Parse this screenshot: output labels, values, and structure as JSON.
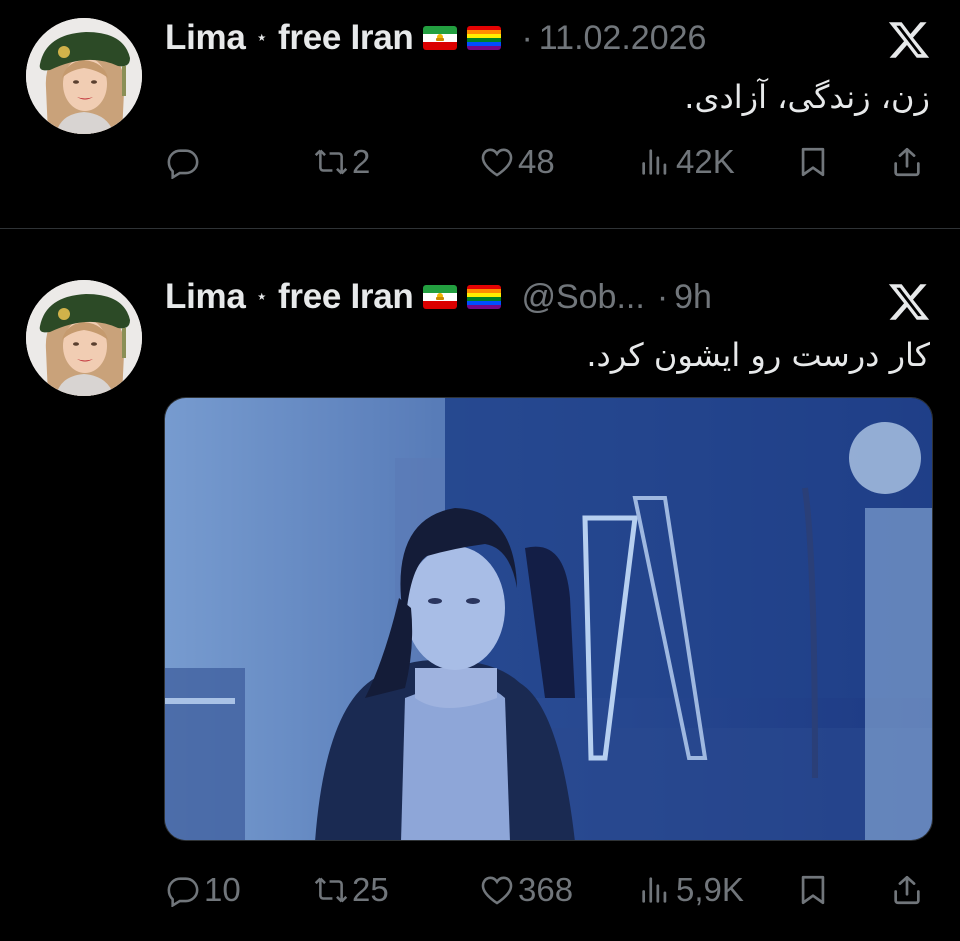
{
  "colors": {
    "background": "#000000",
    "text_primary": "#e7e9ea",
    "text_secondary": "#71767b",
    "divider": "#2f3336"
  },
  "tweets": [
    {
      "author_name": "Lima",
      "badge": "⋆",
      "display_suffix": "free Iran",
      "flags": [
        "iran-lion-sun-flag-icon",
        "rainbow-pride-flag-icon"
      ],
      "handle": "",
      "separator": "·",
      "time": "11.02.2026",
      "text": "زن، زندگی، آزادی.",
      "stats": {
        "replies": "",
        "retweets": "2",
        "likes": "48",
        "views": "42K"
      },
      "has_media": false
    },
    {
      "author_name": "Lima",
      "badge": "⋆",
      "display_suffix": "free Iran",
      "flags": [
        "iran-lion-sun-flag-icon",
        "rainbow-pride-flag-icon"
      ],
      "handle": "@Sob...",
      "separator": "·",
      "time": "9h",
      "text": "کار درست رو ایشون کرد.",
      "stats": {
        "replies": "10",
        "retweets": "25",
        "likes": "368",
        "views": "5,9K"
      },
      "has_media": true
    }
  ],
  "icons": {
    "reply": "reply-bubble-icon",
    "retweet": "retweet-icon",
    "like": "heart-icon",
    "views": "views-bar-chart-icon",
    "bookmark": "bookmark-icon",
    "share": "share-upload-icon",
    "platform": "x-logo-icon"
  }
}
